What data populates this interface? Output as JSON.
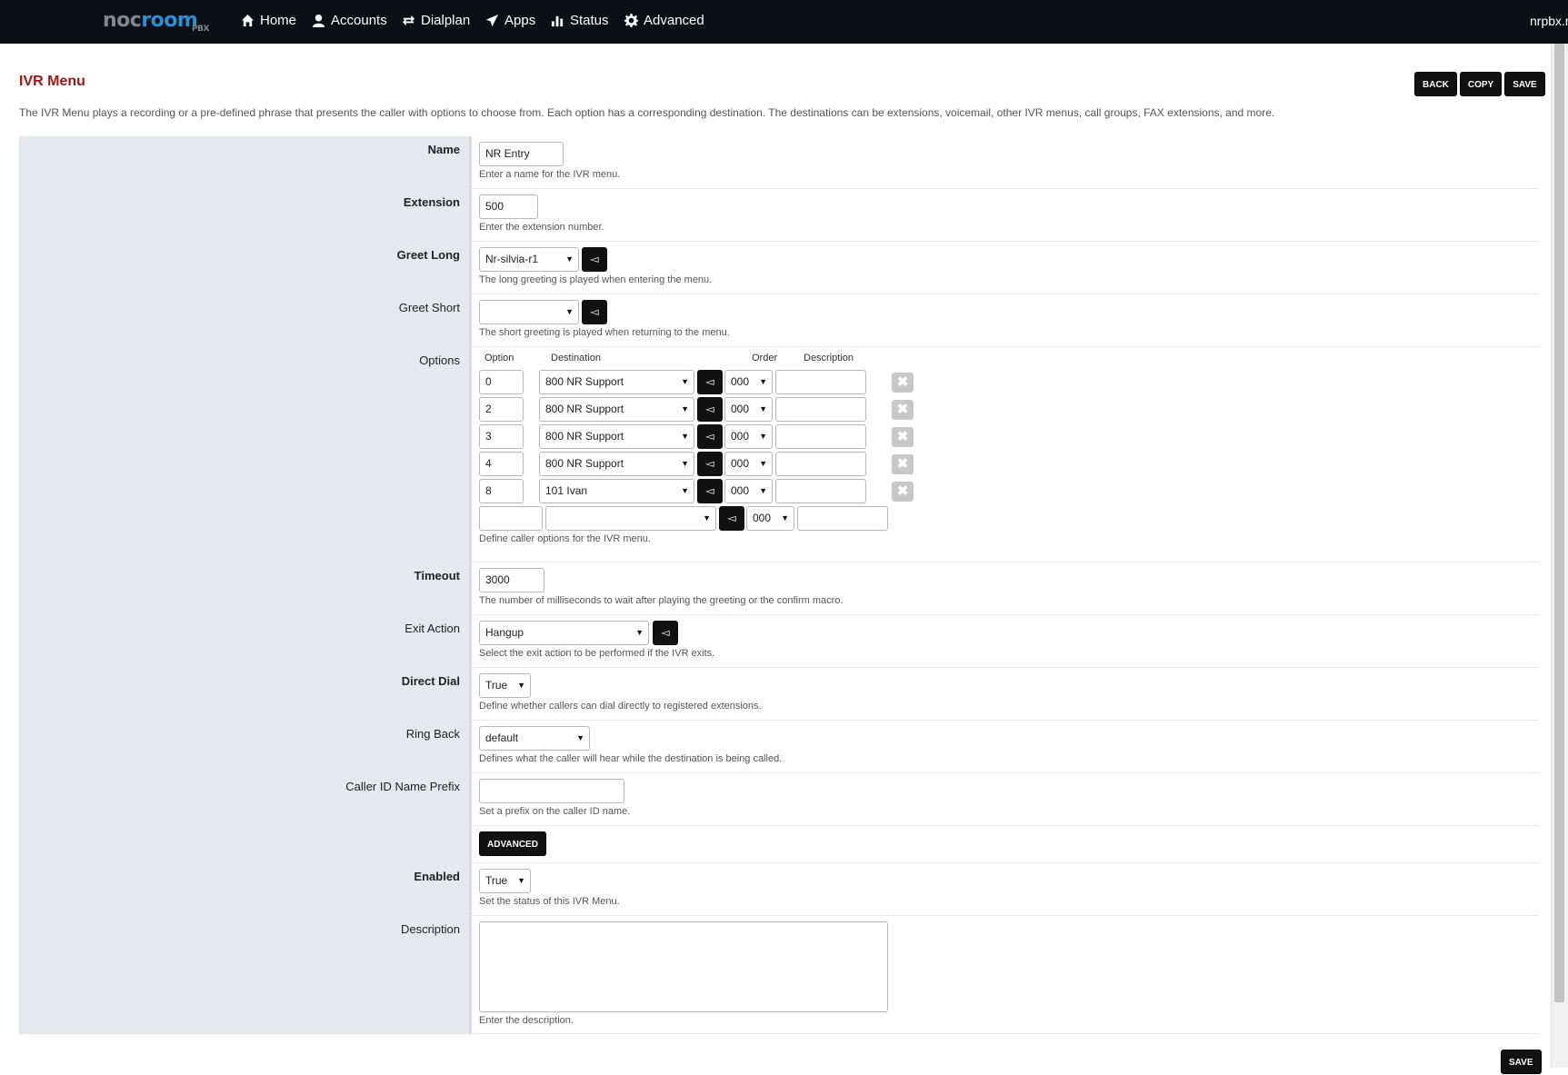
{
  "brand": {
    "logo_a": "noc",
    "logo_b": "room",
    "logo_sub": "PBX"
  },
  "nav": {
    "items": [
      {
        "label": "Home"
      },
      {
        "label": "Accounts"
      },
      {
        "label": "Dialplan"
      },
      {
        "label": "Apps"
      },
      {
        "label": "Status"
      },
      {
        "label": "Advanced"
      }
    ],
    "user": "nrpbx.r"
  },
  "page": {
    "title": "IVR Menu",
    "intro": "The IVR Menu plays a recording or a pre-defined phrase that presents the caller with options to choose from. Each option has a corresponding destination. The destinations can be extensions, voicemail, other IVR menus, call groups, FAX extensions, and more.",
    "buttons": {
      "back": "BACK",
      "copy": "COPY",
      "save": "SAVE"
    }
  },
  "form": {
    "name": {
      "label": "Name",
      "value": "NR Entry",
      "hint": "Enter a name for the IVR menu."
    },
    "extension": {
      "label": "Extension",
      "value": "500",
      "hint": "Enter the extension number."
    },
    "greet_long": {
      "label": "Greet Long",
      "value": "Nr-silvia-r1",
      "hint": "The long greeting is played when entering the menu."
    },
    "greet_short": {
      "label": "Greet Short",
      "value": "",
      "hint": "The short greeting is played when returning to the menu."
    },
    "options": {
      "label": "Options",
      "headers": {
        "option": "Option",
        "destination": "Destination",
        "order": "Order",
        "description": "Description"
      },
      "rows": [
        {
          "option": "0",
          "destination": "800 NR Support",
          "order": "000",
          "description": ""
        },
        {
          "option": "2",
          "destination": "800 NR Support",
          "order": "000",
          "description": ""
        },
        {
          "option": "3",
          "destination": "800 NR Support",
          "order": "000",
          "description": ""
        },
        {
          "option": "4",
          "destination": "800 NR Support",
          "order": "000",
          "description": ""
        },
        {
          "option": "8",
          "destination": "101 Ivan",
          "order": "000",
          "description": ""
        }
      ],
      "new_row": {
        "option": "",
        "destination": "",
        "order": "000",
        "description": ""
      },
      "hint": "Define caller options for the IVR menu."
    },
    "timeout": {
      "label": "Timeout",
      "value": "3000",
      "hint": "The number of milliseconds to wait after playing the greeting or the confirm macro."
    },
    "exit_action": {
      "label": "Exit Action",
      "value": "Hangup",
      "hint": "Select the exit action to be performed if the IVR exits."
    },
    "direct_dial": {
      "label": "Direct Dial",
      "value": "True",
      "hint": "Define whether callers can dial directly to registered extensions."
    },
    "ring_back": {
      "label": "Ring Back",
      "value": "default",
      "hint": "Defines what the caller will hear while the destination is being called."
    },
    "caller_id_prefix": {
      "label": "Caller ID Name Prefix",
      "value": "",
      "hint": "Set a prefix on the caller ID name."
    },
    "advanced_button": "ADVANCED",
    "enabled": {
      "label": "Enabled",
      "value": "True",
      "hint": "Set the status of this IVR Menu."
    },
    "description": {
      "label": "Description",
      "value": "",
      "hint": "Enter the description."
    }
  },
  "icons": {
    "play": "play-icon",
    "remove": "remove-icon"
  }
}
